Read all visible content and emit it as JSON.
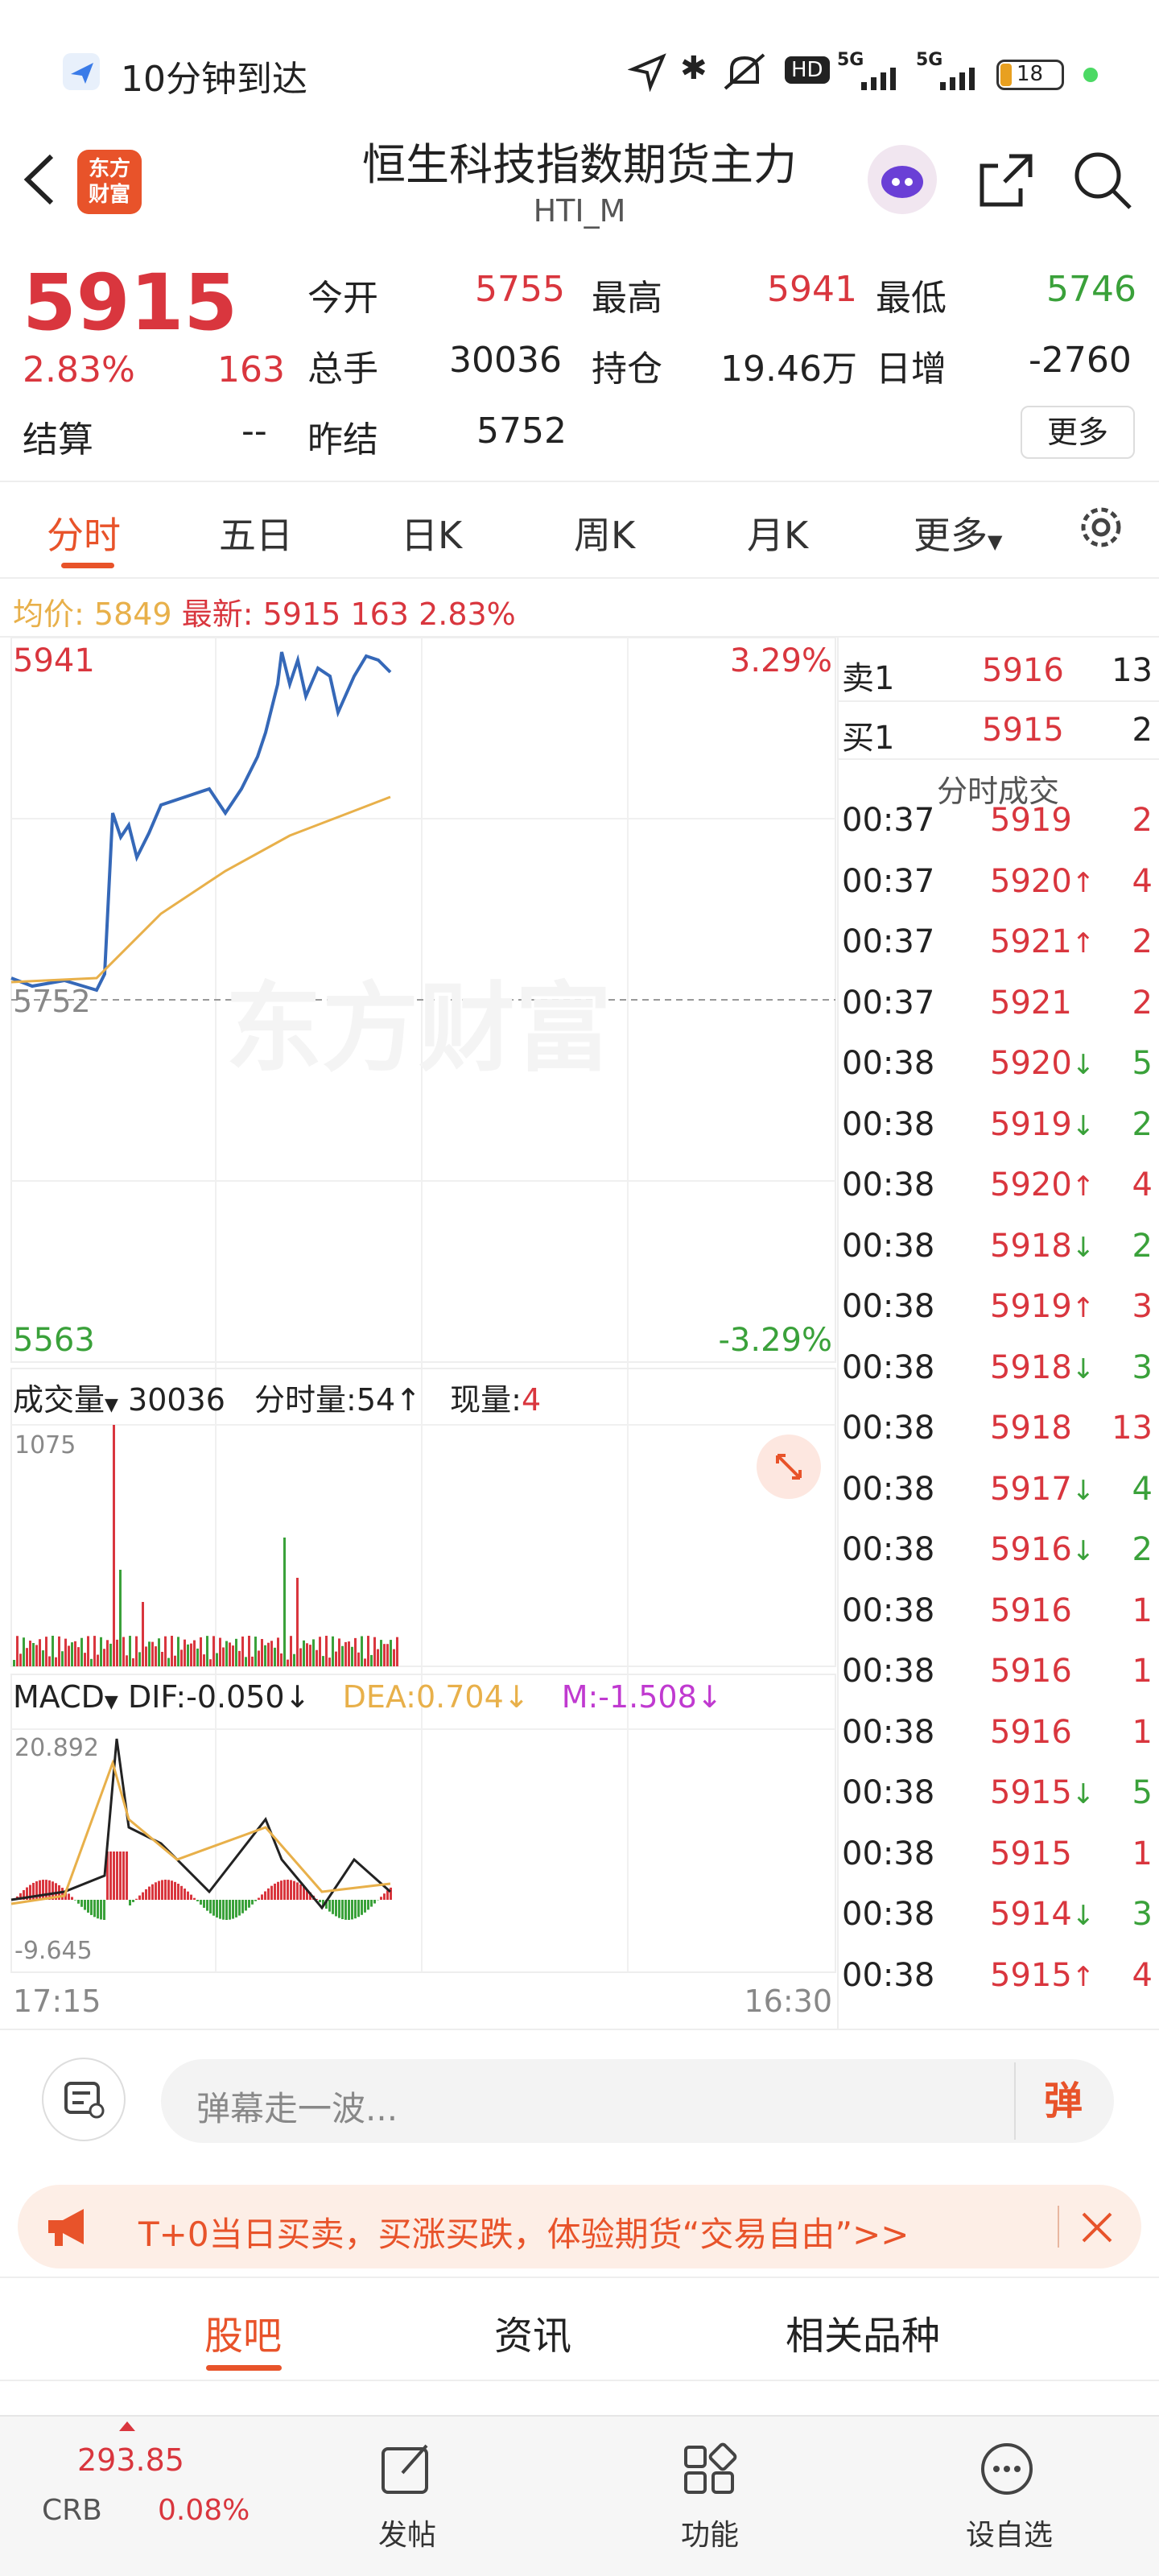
{
  "status": {
    "notification": "10分钟到达",
    "battery": "18",
    "network1": "5G",
    "network2": "5G",
    "hd": "HD"
  },
  "header": {
    "title": "恒生科技指数期货主力",
    "subtitle": "HTI_M",
    "logo_line1": "东方",
    "logo_line2": "财富"
  },
  "quote": {
    "price": "5915",
    "pct": "2.83%",
    "change": "163",
    "open_label": "今开",
    "open": "5755",
    "high_label": "最高",
    "high": "5941",
    "low_label": "最低",
    "low": "5746",
    "vol_label": "总手",
    "vol": "30036",
    "oi_label": "持仓",
    "oi": "19.46万",
    "dinc_label": "日增",
    "dinc": "-2760",
    "settle_label": "结算",
    "settle": "--",
    "prev_label": "昨结",
    "prev": "5752",
    "more_btn": "更多"
  },
  "tabs": [
    "分时",
    "五日",
    "日K",
    "周K",
    "月K",
    "更多"
  ],
  "info": {
    "avg_label": "均价:",
    "avg": "5849",
    "latest_label": "最新:",
    "latest": "5915",
    "change": "163",
    "pct": "2.83%"
  },
  "chart": {
    "y_high": "5941",
    "y_low": "5563",
    "y_mid": "5752",
    "pct_high": "3.29%",
    "pct_low": "-3.29%",
    "watermark": "东方财富",
    "vol_label": "成交量",
    "vol_total": "30036",
    "vol_min_label": "分时量:54",
    "vol_now_label": "现量:",
    "vol_now": "4",
    "vol_max": "1075",
    "macd_label": "MACD",
    "dif": "DIF:-0.050",
    "dea": "DEA:0.704",
    "m": "M:-1.508",
    "macd_max": "20.892",
    "macd_min": "-9.645",
    "time_start": "17:15",
    "time_end": "16:30"
  },
  "orderbook": {
    "sell_label": "卖1",
    "sell_price": "5916",
    "sell_vol": "13",
    "buy_label": "买1",
    "buy_price": "5915",
    "buy_vol": "2",
    "trades_title": "分时成交"
  },
  "trades": [
    [
      "00:37",
      "5919",
      "",
      "2"
    ],
    [
      "00:37",
      "5920",
      "up",
      "4"
    ],
    [
      "00:37",
      "5921",
      "up",
      "2"
    ],
    [
      "00:37",
      "5921",
      "",
      "2"
    ],
    [
      "00:38",
      "5920",
      "down",
      "5"
    ],
    [
      "00:38",
      "5919",
      "down",
      "2"
    ],
    [
      "00:38",
      "5920",
      "up",
      "4"
    ],
    [
      "00:38",
      "5918",
      "down",
      "2"
    ],
    [
      "00:38",
      "5919",
      "up",
      "3"
    ],
    [
      "00:38",
      "5918",
      "down",
      "3"
    ],
    [
      "00:38",
      "5918",
      "",
      "13"
    ],
    [
      "00:38",
      "5917",
      "down",
      "4"
    ],
    [
      "00:38",
      "5916",
      "down",
      "2"
    ],
    [
      "00:38",
      "5916",
      "",
      "1"
    ],
    [
      "00:38",
      "5916",
      "",
      "1"
    ],
    [
      "00:38",
      "5916",
      "",
      "1"
    ],
    [
      "00:38",
      "5915",
      "down",
      "5"
    ],
    [
      "00:38",
      "5915",
      "",
      "1"
    ],
    [
      "00:38",
      "5914",
      "down",
      "3"
    ],
    [
      "00:38",
      "5915",
      "up",
      "4"
    ]
  ],
  "comment": {
    "placeholder": "弹幕走一波...",
    "btn": "弹"
  },
  "banner": {
    "text": "T+0当日买卖，买涨买跌，体验期货“交易自由”>>"
  },
  "bottom_tabs": [
    "股吧",
    "资讯",
    "相关品种"
  ],
  "nav": {
    "crb_value": "293.85",
    "crb_label": "CRB",
    "crb_pct": "0.08%",
    "post": "发帖",
    "func": "功能",
    "watch": "设自选"
  }
}
